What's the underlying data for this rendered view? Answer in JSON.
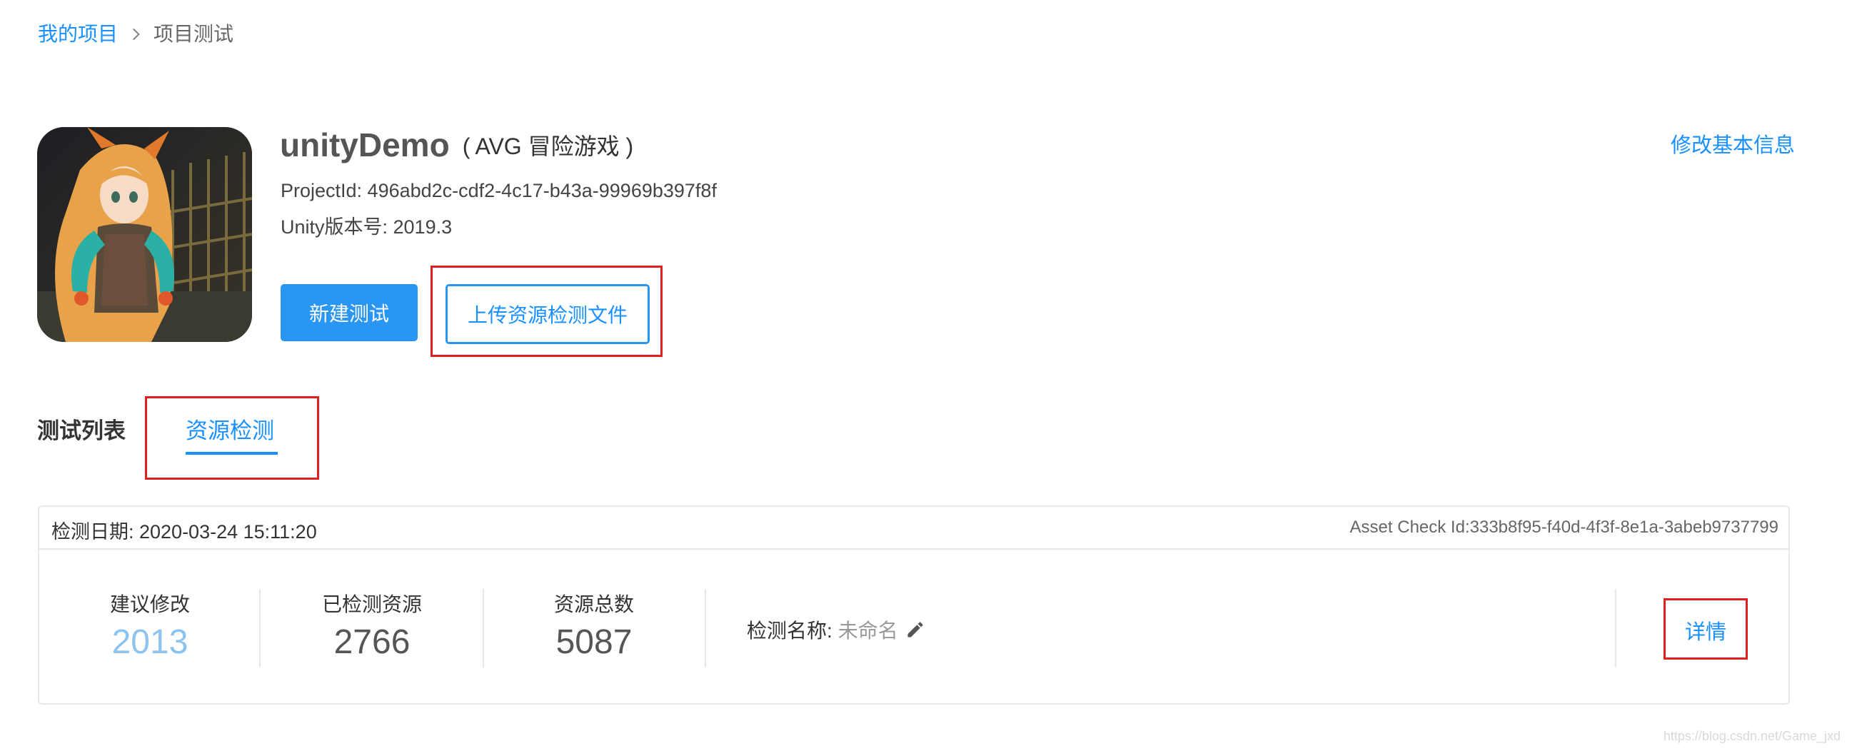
{
  "breadcrumb": {
    "root": "我的项目",
    "current": "项目测试"
  },
  "project": {
    "name": "unityDemo",
    "genre": "( AVG 冒险游戏 )",
    "project_id_line": "ProjectId: 496abd2c-cdf2-4c17-b43a-99969b397f8f",
    "unity_version_line": "Unity版本号:  2019.3",
    "edit_link": "修改基本信息"
  },
  "actions": {
    "new_test": "新建测试",
    "upload_check": "上传资源检测文件"
  },
  "tabs": [
    {
      "label": "测试列表"
    },
    {
      "label": "资源检测",
      "active": true
    }
  ],
  "card": {
    "date_line": "检测日期: 2020-03-24 15:11:20",
    "asset_check_id": "Asset Check Id:333b8f95-f40d-4f3f-8e1a-3abeb9737799",
    "stats": [
      {
        "label": "建议修改",
        "value": "2013",
        "color": "#8cc4ef"
      },
      {
        "label": "已检测资源",
        "value": "2766",
        "color": "#555555"
      },
      {
        "label": "资源总数",
        "value": "5087",
        "color": "#555555"
      }
    ],
    "check_name_label": "检测名称:",
    "check_name_value": "未命名",
    "detail": "详情"
  },
  "watermark": "https://blog.csdn.net/Game_jxd",
  "colors": {
    "accent": "#1890ff",
    "primary_button": "#2996f3",
    "highlight_box": "#e02020"
  }
}
